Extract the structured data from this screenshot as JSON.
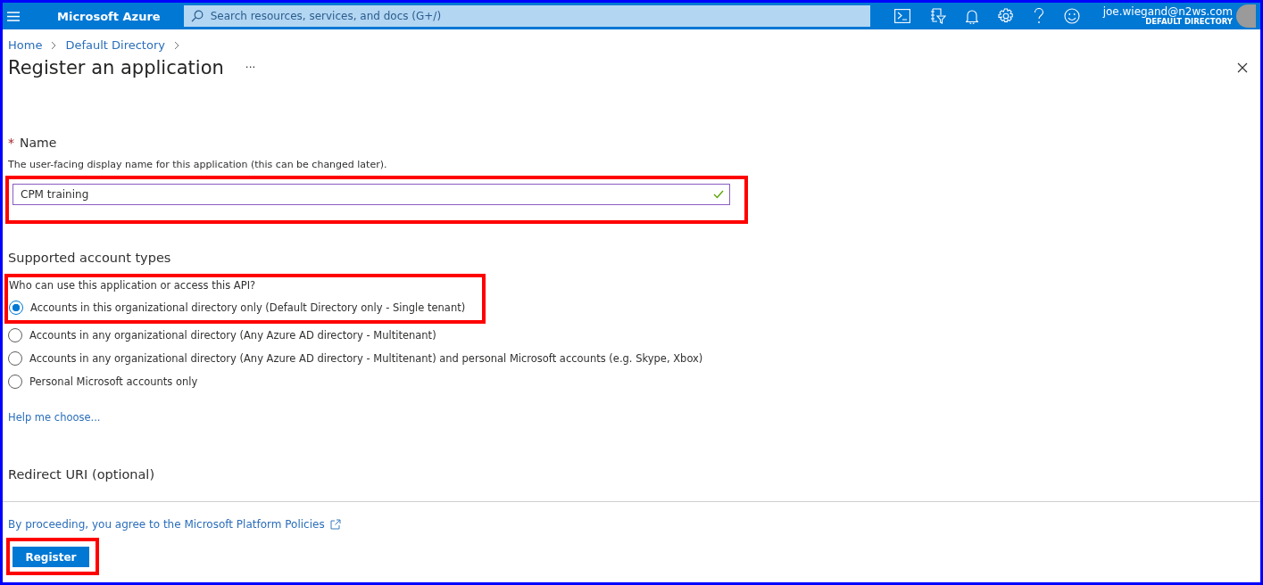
{
  "top_bar": {
    "product": "Microsoft Azure",
    "search": {
      "placeholder": "Search resources, services, and docs (G+/)"
    },
    "user": {
      "email": "joe.wiegand@n2ws.com",
      "directory": "DEFAULT DIRECTORY"
    }
  },
  "breadcrumb": [
    "Home",
    "Default Directory"
  ],
  "page": {
    "title": "Register an application",
    "more": "···"
  },
  "name_section": {
    "label": "Name",
    "required_mark": "*",
    "description": "The user-facing display name for this application (this can be changed later).",
    "value": "CPM training",
    "valid": true
  },
  "account_types": {
    "heading": "Supported account types",
    "question": "Who can use this application or access this API?",
    "options": [
      {
        "label": "Accounts in this organizational directory only (Default Directory only - Single tenant)",
        "selected": true
      },
      {
        "label": "Accounts in any organizational directory (Any Azure AD directory - Multitenant)",
        "selected": false
      },
      {
        "label": "Accounts in any organizational directory (Any Azure AD directory - Multitenant) and personal Microsoft accounts (e.g. Skype, Xbox)",
        "selected": false
      },
      {
        "label": "Personal Microsoft accounts only",
        "selected": false
      }
    ],
    "help_link": "Help me choose..."
  },
  "redirect": {
    "heading": "Redirect URI (optional)"
  },
  "footer": {
    "policy_link": "By proceeding, you agree to the Microsoft Platform Policies",
    "button": "Register"
  }
}
